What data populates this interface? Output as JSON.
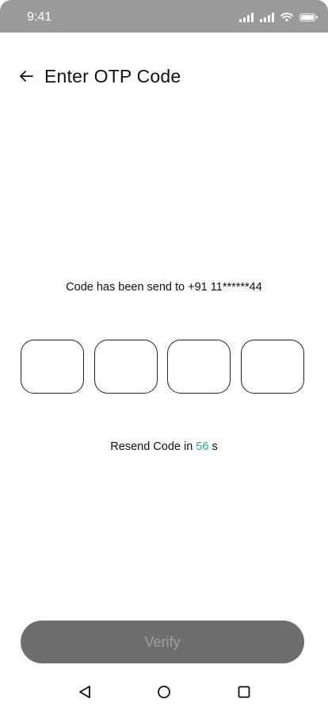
{
  "status_bar": {
    "time": "9:41",
    "icons": [
      "signal-icon",
      "signal-icon",
      "wifi-icon",
      "battery-icon"
    ],
    "background": "#9a9a9a"
  },
  "header": {
    "back_icon": "arrow-left-icon",
    "title": "Enter OTP Code"
  },
  "message": {
    "text": "Code has been send to +91 11******44"
  },
  "otp": {
    "digits": [
      "",
      "",
      "",
      ""
    ]
  },
  "resend": {
    "prefix": "Resend Code in ",
    "seconds": "56",
    "suffix": " s",
    "accent_color": "#1aaf9a"
  },
  "verify": {
    "label": "Verify",
    "background": "#6e6e6e",
    "text_color": "#9f9f9f"
  },
  "nav": {
    "icons": [
      "back-triangle-icon",
      "home-circle-icon",
      "recents-square-icon"
    ]
  }
}
